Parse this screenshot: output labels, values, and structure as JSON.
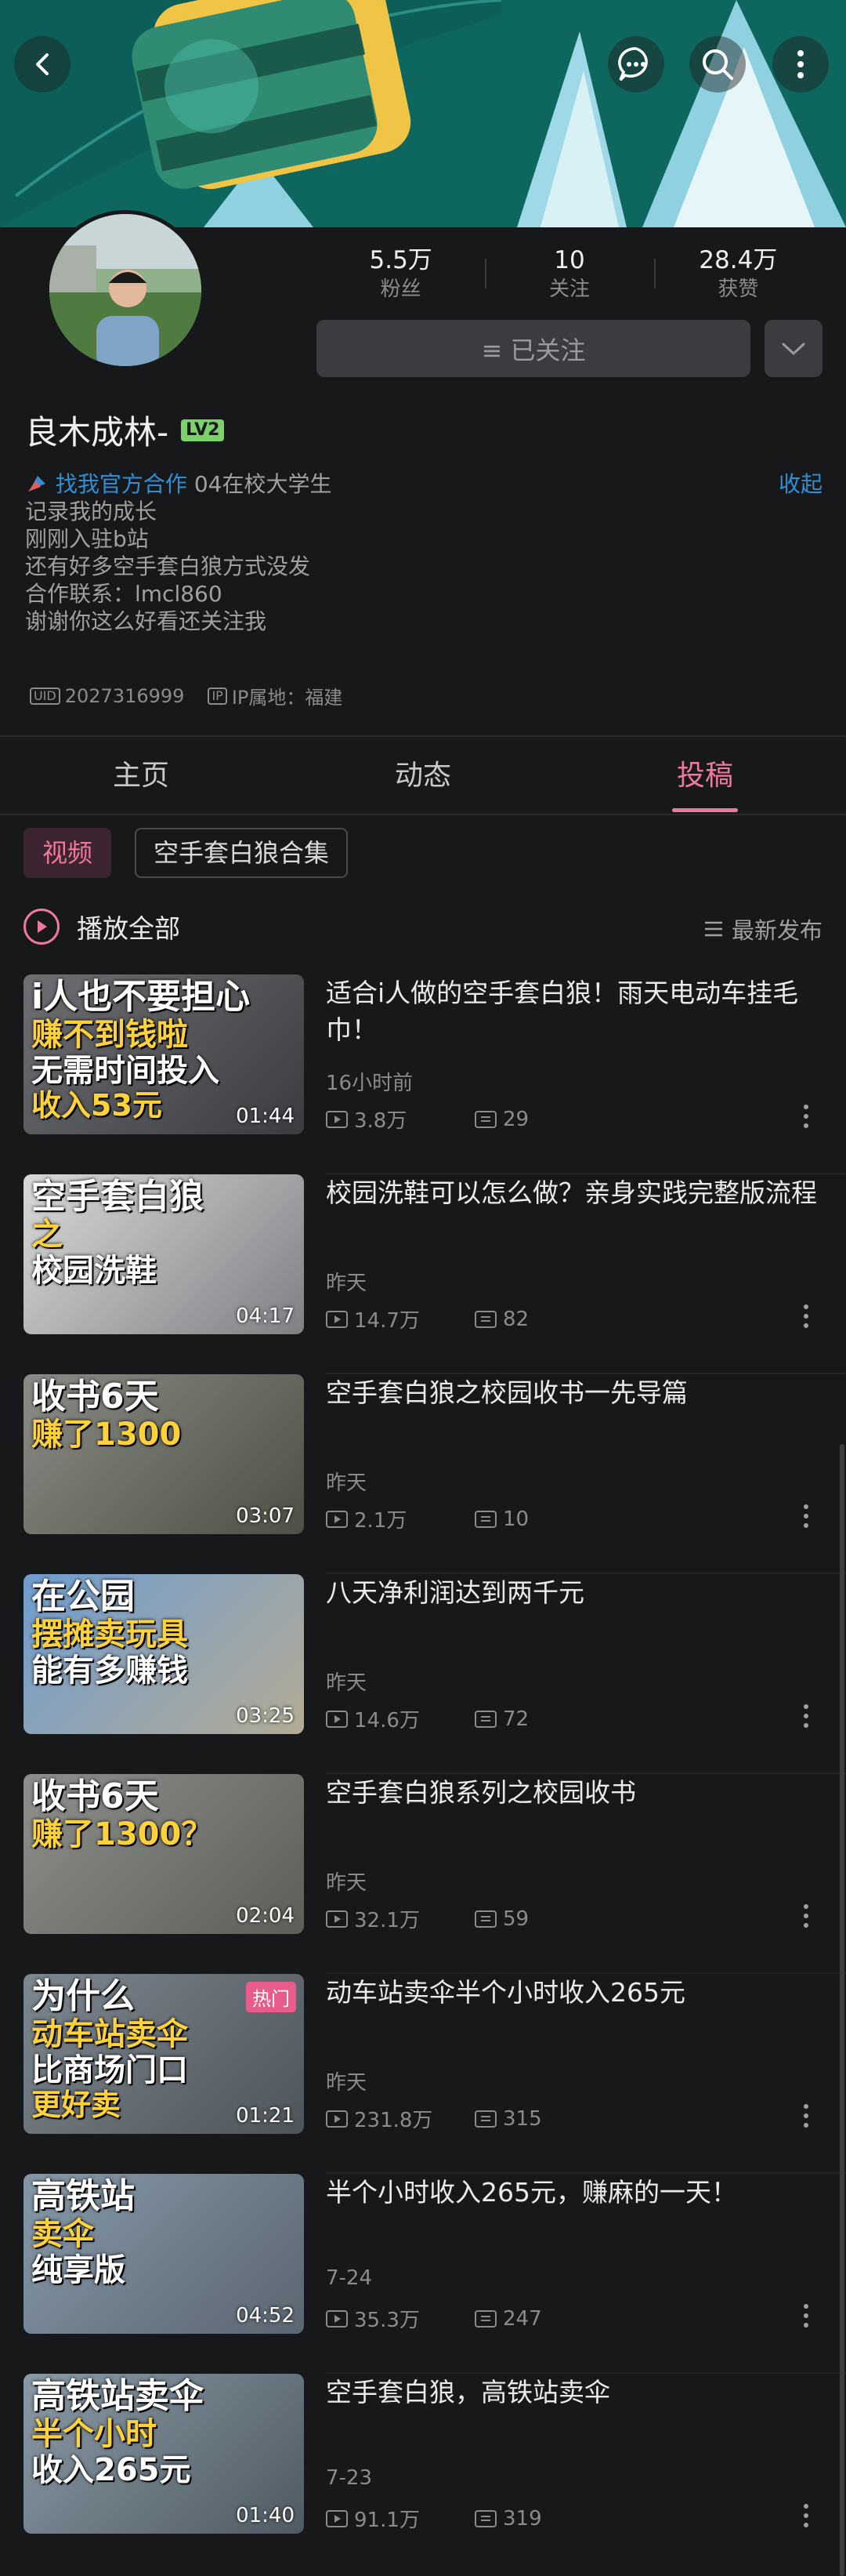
{
  "header": {
    "back_icon": "back-arrow-icon",
    "chat_icon": "chat-bubble-icon",
    "search_icon": "search-icon",
    "more_icon": "more-vertical-icon"
  },
  "profile": {
    "name": "良木成林-",
    "level": "LV2",
    "stats": [
      {
        "num": "5.5万",
        "label": "粉丝"
      },
      {
        "num": "10",
        "label": "关注"
      },
      {
        "num": "28.4万",
        "label": "获赞"
      }
    ],
    "follow_label": "≡ 已关注",
    "official": "找我官方合作",
    "bio_first": "04在校大学生",
    "bio_lines": [
      "记录我的成长",
      "刚刚入驻b站",
      "还有好多空手套白狼方式没发",
      "合作联系：lmcl860",
      "谢谢你这么好看还关注我"
    ],
    "collapse": "收起",
    "uid_tag": "UID",
    "uid": "2027316999",
    "ip_tag": "IP",
    "ip": "IP属地：福建"
  },
  "tabs": [
    "主页",
    "动态",
    "投稿"
  ],
  "chips": [
    "视频",
    "空手套白狼合集"
  ],
  "list_header": {
    "play_all": "播放全部",
    "sort": "最新发布"
  },
  "videos": [
    {
      "title": "适合i人做的空手套白狼！雨天电动车挂毛巾！",
      "date": "16小时前",
      "views": "3.8万",
      "comments": "29",
      "duration": "01:44",
      "cap1": "i人也不要担心",
      "cap2": "赚不到钱啦",
      "cap3": "无需时间投入",
      "cap4": "收入53元",
      "colors": [
        "#6d6f73",
        "#3a3c40"
      ]
    },
    {
      "title": "校园洗鞋可以怎么做？亲身实践完整版流程",
      "date": "昨天",
      "views": "14.7万",
      "comments": "82",
      "duration": "04:17",
      "cap1": "空手套白狼",
      "cap2": "之",
      "cap3": "校园洗鞋",
      "colors": [
        "#d9d9d9",
        "#7e8084"
      ]
    },
    {
      "title": "空手套白狼之校园收书一先导篇",
      "date": "昨天",
      "views": "2.1万",
      "comments": "10",
      "duration": "03:07",
      "cap1": "收书6天",
      "cap2": "赚了1300",
      "colors": [
        "#8a8c86",
        "#4d5044"
      ]
    },
    {
      "title": "八天净利润达到两千元",
      "date": "昨天",
      "views": "14.6万",
      "comments": "72",
      "duration": "03:25",
      "cap1": "在公园",
      "cap2": "摆摊卖玩具",
      "cap3": "能有多赚钱",
      "colors": [
        "#6f9cd0",
        "#b3ab94"
      ]
    },
    {
      "title": "空手套白狼系列之校园收书",
      "date": "昨天",
      "views": "32.1万",
      "comments": "59",
      "duration": "02:04",
      "cap1": "收书6天",
      "cap2": "赚了1300？",
      "colors": [
        "#8e8f8c",
        "#5c5f58"
      ]
    },
    {
      "title": "动车站卖伞半个小时收入265元",
      "date": "昨天",
      "views": "231.8万",
      "comments": "315",
      "duration": "01:21",
      "hot": "热门",
      "cap1": "为什么",
      "cap2": "动车站卖伞",
      "cap3": "比商场门口",
      "cap4": "更好卖",
      "colors": [
        "#7d8790",
        "#4e555a"
      ]
    },
    {
      "title": "半个小时收入265元，赚麻的一天！",
      "date": "7-24",
      "views": "35.3万",
      "comments": "247",
      "duration": "04:52",
      "cap1": "高铁站",
      "cap2": "卖伞",
      "cap3": "纯享版",
      "colors": [
        "#8598a8",
        "#5b6670"
      ]
    },
    {
      "title": "空手套白狼，高铁站卖伞",
      "date": "7-23",
      "views": "91.1万",
      "comments": "319",
      "duration": "01:40",
      "cap1": "高铁站卖伞",
      "cap2": "半个小时",
      "cap3": "收入265元",
      "colors": [
        "#8a9aa6",
        "#4f5b63"
      ]
    }
  ]
}
